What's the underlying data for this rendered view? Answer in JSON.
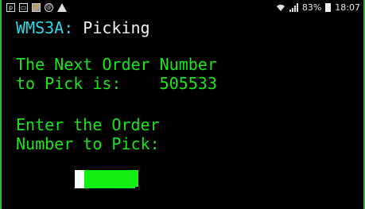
{
  "status_bar": {
    "left_icons": [
      "p-notification-icon",
      "message-icon",
      "image-icon",
      "at-icon",
      "warning-icon"
    ],
    "left_glyphs": [
      "p",
      "▭",
      "",
      "@",
      ""
    ],
    "battery_percent": "83%",
    "time": "18:07"
  },
  "terminal": {
    "app_code": "WMS3A:",
    "screen_title": " Picking",
    "next_order_line1": "The Next Order Number",
    "next_order_line2_label": "to Pick is:",
    "next_order_number": "505533",
    "prompt_line1": "Enter the Order",
    "prompt_line2": "Number to Pick:",
    "order_input_value": ""
  },
  "colors": {
    "background": "#000000",
    "terminal_text": "#19e619",
    "app_code": "#2bd8e6",
    "title_text": "#f2f2f2",
    "input_field": "#11ee11",
    "border": "#22c322"
  }
}
